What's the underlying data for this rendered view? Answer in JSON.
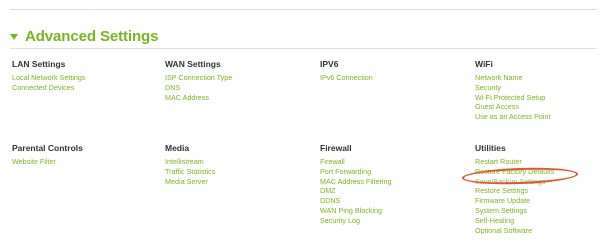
{
  "section": {
    "title": "Advanced Settings"
  },
  "groups": {
    "lan": {
      "title": "LAN Settings",
      "items": [
        "Local Network Settings",
        "Connected Devices"
      ]
    },
    "wan": {
      "title": "WAN Settings",
      "items": [
        "ISP Connection Type",
        "DNS",
        "MAC Address"
      ]
    },
    "ipv6": {
      "title": "IPV6",
      "items": [
        "IPv6 Connection"
      ]
    },
    "wifi": {
      "title": "WiFi",
      "items": [
        "Network Name",
        "Security",
        "Wi-Fi Protected Setup",
        "Guest Access",
        "Use as an Access Point"
      ]
    },
    "parental": {
      "title": "Parental Controls",
      "items": [
        "Website Filter"
      ]
    },
    "media": {
      "title": "Media",
      "items": [
        "Intellistream",
        "Traffic Statistics",
        "Media Server"
      ]
    },
    "firewall": {
      "title": "Firewall",
      "items": [
        "Firewall",
        "Port Forwarding",
        "MAC Address Filtering",
        "DMZ",
        "DDNS",
        "WAN Ping Blocking",
        "Security Log"
      ]
    },
    "utilities": {
      "title": "Utilities",
      "items": [
        "Restart Router",
        "Restore Factory Defaults",
        "Save/Backup Settings",
        "Restore Settings",
        "Firmware Update",
        "System Settings",
        "Self-Healing",
        "Optional Software"
      ]
    }
  },
  "colors": {
    "accent": "#7ab51d",
    "heading": "#333333",
    "highlight": "#e0552e"
  }
}
